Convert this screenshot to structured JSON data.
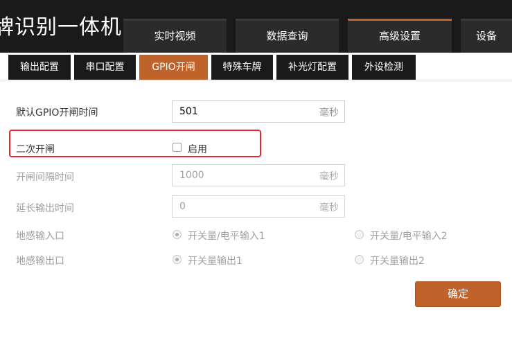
{
  "header": {
    "title": "牌识别一体机",
    "nav_tabs": [
      {
        "label": "实时视频"
      },
      {
        "label": "数据查询"
      },
      {
        "label": "高级设置",
        "active": true
      },
      {
        "label": "设备"
      }
    ]
  },
  "subtabs": [
    {
      "label": "输出配置"
    },
    {
      "label": "串口配置"
    },
    {
      "label": "GPIO开闸",
      "active": true
    },
    {
      "label": "特殊车牌"
    },
    {
      "label": "补光灯配置"
    },
    {
      "label": "外设检测"
    }
  ],
  "form": {
    "default_open_time": {
      "label": "默认GPIO开闸时间",
      "value": "501",
      "unit": "毫秒"
    },
    "second_open": {
      "label": "二次开闸",
      "checkbox_label": "启用",
      "checked": false
    },
    "open_interval": {
      "label": "开闸间隔时间",
      "value": "1000",
      "unit": "毫秒"
    },
    "delay_output": {
      "label": "延长输出时间",
      "value": "0",
      "unit": "毫秒"
    },
    "loop_input": {
      "label": "地感输入口",
      "options": [
        "开关量/电平输入1",
        "开关量/电平输入2"
      ],
      "selected": 0
    },
    "loop_output": {
      "label": "地感输出口",
      "options": [
        "开关量输出1",
        "开关量输出2"
      ],
      "selected": 0
    }
  },
  "confirm_label": "确定",
  "colors": {
    "accent": "#c0632a",
    "header_bg": "#1a1a1a",
    "highlight": "#e8262d"
  }
}
